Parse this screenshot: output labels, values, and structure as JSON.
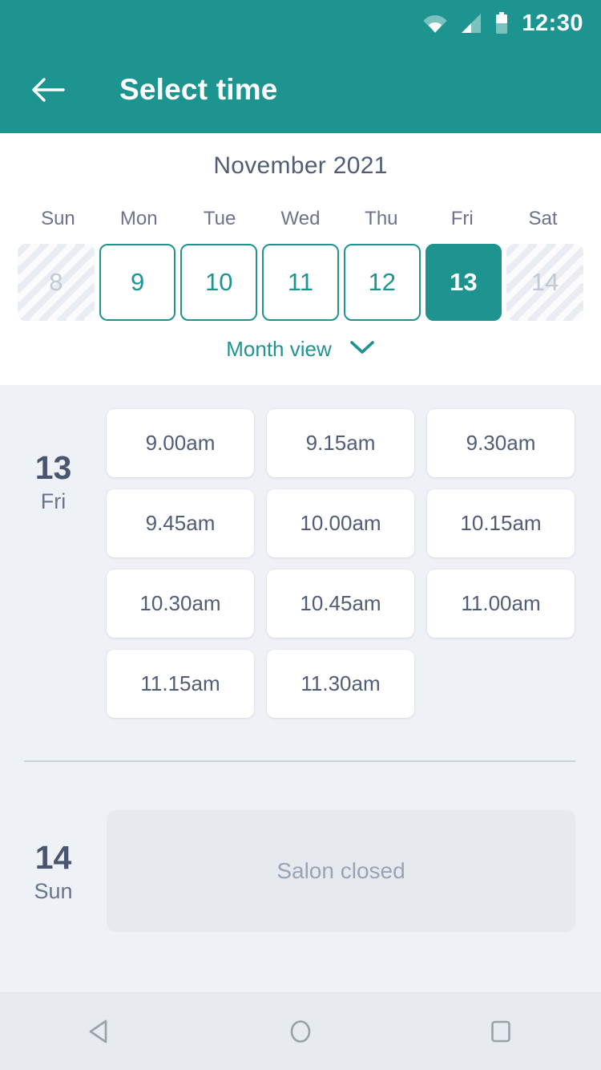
{
  "status_bar": {
    "time": "12:30",
    "icons": [
      "wifi-icon",
      "cellular-signal-icon",
      "battery-icon"
    ]
  },
  "app_bar": {
    "back_icon": "back-arrow-icon",
    "title": "Select time"
  },
  "calendar": {
    "month_title": "November 2021",
    "weekdays": [
      "Sun",
      "Mon",
      "Tue",
      "Wed",
      "Thu",
      "Fri",
      "Sat"
    ],
    "days": [
      {
        "number": "8",
        "state": "disabled"
      },
      {
        "number": "9",
        "state": "available"
      },
      {
        "number": "10",
        "state": "available"
      },
      {
        "number": "11",
        "state": "available"
      },
      {
        "number": "12",
        "state": "available"
      },
      {
        "number": "13",
        "state": "selected"
      },
      {
        "number": "14",
        "state": "disabled"
      }
    ],
    "month_view_label": "Month view",
    "month_view_icon": "chevron-down-icon"
  },
  "schedule": [
    {
      "day_number": "13",
      "day_name": "Fri",
      "slots": [
        "9.00am",
        "9.15am",
        "9.30am",
        "9.45am",
        "10.00am",
        "10.15am",
        "10.30am",
        "10.45am",
        "11.00am",
        "11.15am",
        "11.30am"
      ]
    },
    {
      "day_number": "14",
      "day_name": "Sun",
      "closed_message": "Salon closed"
    }
  ],
  "nav_bar": {
    "back_icon": "android-back-icon",
    "home_icon": "android-home-icon",
    "recents_icon": "android-recents-icon"
  },
  "colors": {
    "accent": "#1d9490",
    "background": "#eef1f6",
    "panel": "#ffffff",
    "text_dark": "#505d76",
    "text_muted": "#9aa3b4",
    "closed_card": "#e6e9ed"
  }
}
